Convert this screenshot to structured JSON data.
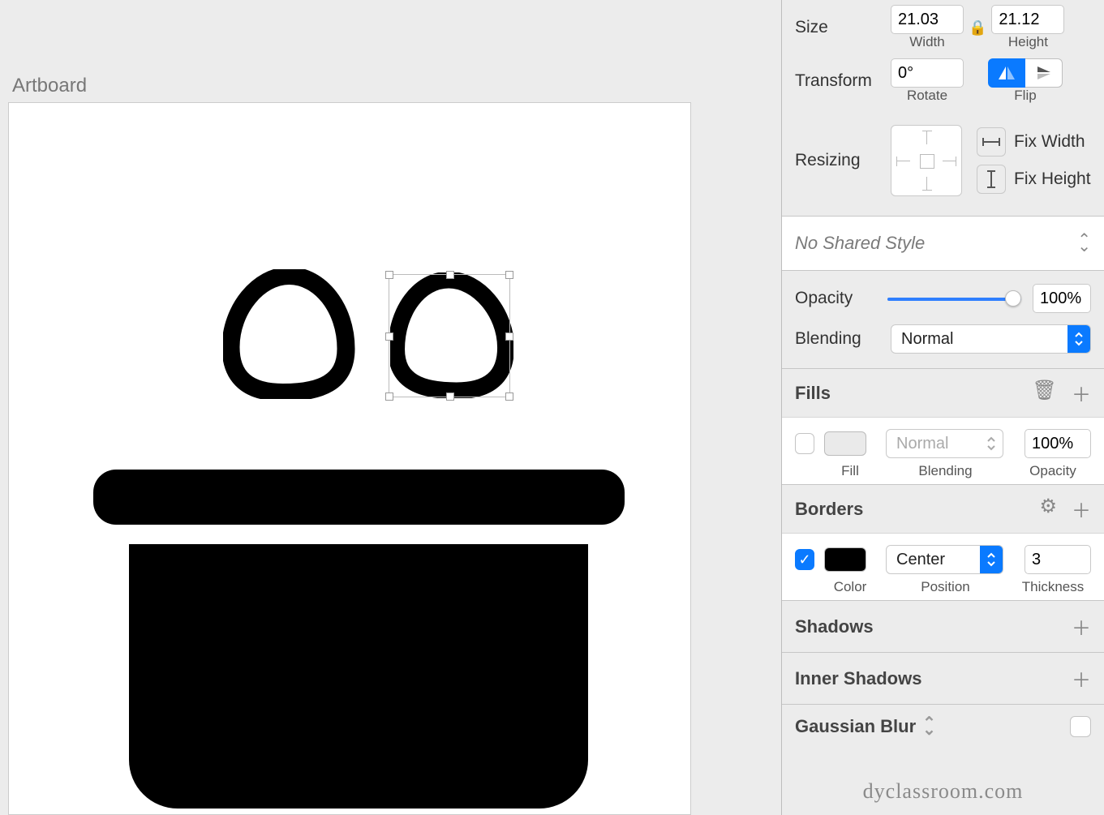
{
  "canvas": {
    "artboard_label": "Artboard"
  },
  "inspector": {
    "size": {
      "label": "Size",
      "width_value": "21.03",
      "width_caption": "Width",
      "height_value": "21.12",
      "height_caption": "Height"
    },
    "transform": {
      "label": "Transform",
      "rotate_value": "0°",
      "rotate_caption": "Rotate",
      "flip_caption": "Flip"
    },
    "resizing": {
      "label": "Resizing",
      "fix_width_label": "Fix Width",
      "fix_height_label": "Fix Height"
    },
    "shared_style": {
      "label": "No Shared Style"
    },
    "opacity": {
      "label": "Opacity",
      "value": "100%",
      "percent": 100
    },
    "blending": {
      "label": "Blending",
      "value": "Normal"
    },
    "fills": {
      "title": "Fills",
      "enabled": false,
      "fill_caption": "Fill",
      "blend_value": "Normal",
      "blend_caption": "Blending",
      "opacity_value": "100%",
      "opacity_caption": "Opacity"
    },
    "borders": {
      "title": "Borders",
      "enabled": true,
      "color": "#000000",
      "color_caption": "Color",
      "position_value": "Center",
      "position_caption": "Position",
      "thickness_value": "3",
      "thickness_caption": "Thickness"
    },
    "shadows": {
      "title": "Shadows"
    },
    "inner_shadows": {
      "title": "Inner Shadows"
    },
    "gaussian_blur": {
      "title": "Gaussian Blur",
      "enabled": false
    }
  },
  "watermark": "dyclassroom.com"
}
